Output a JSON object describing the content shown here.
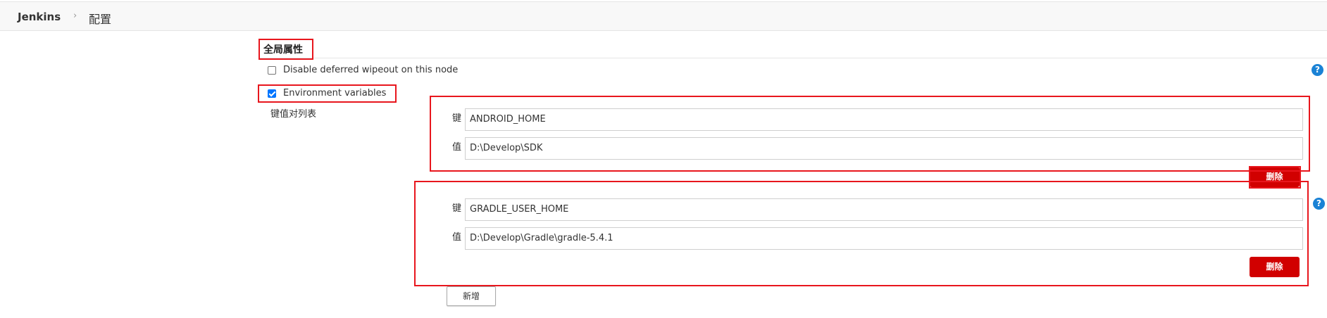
{
  "breadcrumb": {
    "root": "Jenkins",
    "separator": "›",
    "current": "配置"
  },
  "section": {
    "title": "全局属性"
  },
  "options": {
    "wipeout_label": "Disable deferred wipeout on this node",
    "wipeout_checked": false,
    "env_label": "Environment variables",
    "env_checked": true
  },
  "env_vars": {
    "list_label": "键值对列表",
    "key_label": "键",
    "value_label": "值",
    "entries": [
      {
        "key": "ANDROID_HOME",
        "value": "D:\\Develop\\SDK"
      },
      {
        "key": "GRADLE_USER_HOME",
        "value": "D:\\Develop\\Gradle\\gradle-5.4.1"
      }
    ],
    "delete_label": "删除",
    "add_label": "新增"
  },
  "help_icon_glyph": "?",
  "colors": {
    "annotation": "#e8161d",
    "delete_button": "#d10000",
    "help_icon": "#1a82d5",
    "checkbox_checked": "#0075ff"
  }
}
